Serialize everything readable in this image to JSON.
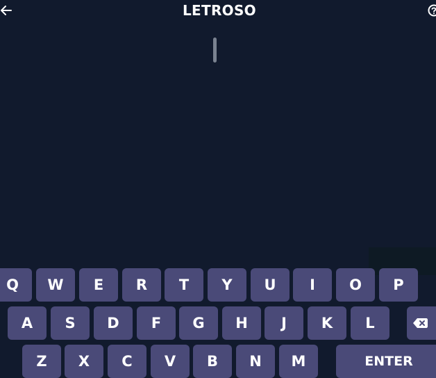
{
  "header": {
    "title": "LETROSO",
    "back_icon": "arrow-left-icon",
    "help_icon": "question-circle-icon"
  },
  "colors": {
    "background": "#111a2d",
    "key": "#4a4a78",
    "text": "#ffffff"
  },
  "keyboard": {
    "row1": [
      "Q",
      "W",
      "E",
      "R",
      "T",
      "Y",
      "U",
      "I",
      "O",
      "P"
    ],
    "row2": [
      "A",
      "S",
      "D",
      "F",
      "G",
      "H",
      "J",
      "K",
      "L"
    ],
    "row3": [
      "Z",
      "X",
      "C",
      "V",
      "B",
      "N",
      "M"
    ],
    "enter_label": "ENTER",
    "delete_icon": "backspace-icon"
  }
}
